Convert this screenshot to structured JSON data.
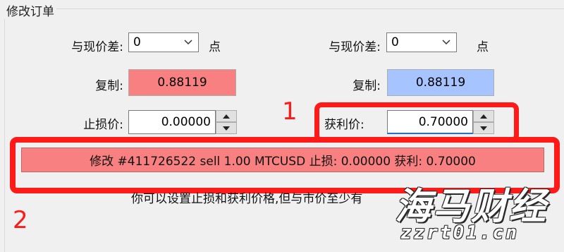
{
  "dialog": {
    "group_title": "修改订单"
  },
  "stop_loss": {
    "diff_label": "与现价差:",
    "diff_value": "0",
    "diff_unit": "点",
    "copy_label": "复制:",
    "copy_value": "0.88119",
    "price_label": "止损价:",
    "price_value": "0.00000"
  },
  "take_profit": {
    "diff_label": "与现价差:",
    "diff_value": "0",
    "diff_unit": "点",
    "copy_label": "复制:",
    "copy_value": "0.88119",
    "price_label": "获利价:",
    "price_value": "0.70000"
  },
  "modify_button": {
    "label": "修改  #411726522 sell 1.00 MTCUSD 止损: 0.00000 获利: 0.70000"
  },
  "hint": {
    "text": "你可以设置止损和获利价格,但与市价至少有"
  },
  "annotations": {
    "one": "1",
    "two": "2"
  },
  "watermark": {
    "cn": "海马财经",
    "url": "zzrt01.cn"
  },
  "colors": {
    "sl_copy": "#f88080",
    "tp_copy": "#a6c4ff",
    "annotation": "#ff1a1a"
  },
  "icons": {
    "dropdown": "chevron-down-icon",
    "spin_up": "caret-up-icon",
    "spin_down": "caret-down-icon"
  }
}
